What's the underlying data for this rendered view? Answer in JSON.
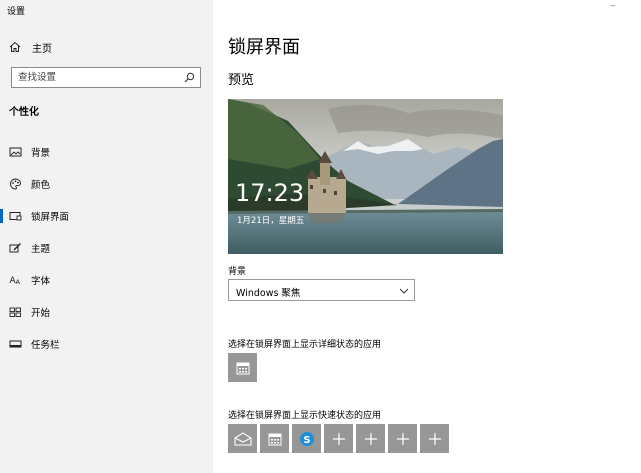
{
  "app": {
    "title": "设置",
    "minimize_glyph": "‒"
  },
  "sidebar": {
    "home_label": "主页",
    "search": {
      "placeholder": "查找设置",
      "value": ""
    },
    "section_title": "个性化",
    "items": [
      {
        "label": "背景",
        "icon": "picture-icon"
      },
      {
        "label": "颜色",
        "icon": "palette-icon"
      },
      {
        "label": "锁屏界面",
        "icon": "lockscreen-icon",
        "active": true
      },
      {
        "label": "主题",
        "icon": "theme-brush-icon"
      },
      {
        "label": "字体",
        "icon": "font-icon"
      },
      {
        "label": "开始",
        "icon": "start-grid-icon"
      },
      {
        "label": "任务栏",
        "icon": "taskbar-icon"
      }
    ]
  },
  "main": {
    "title": "锁屏界面",
    "preview_heading": "预览",
    "preview": {
      "time": "17:23",
      "date": "1月21日，星期五"
    },
    "background_label": "背景",
    "background_select": {
      "value": "Windows 聚焦"
    },
    "detailed_status_label": "选择在锁屏界面上显示详细状态的应用",
    "detailed_status_apps": [
      {
        "icon": "calendar-icon"
      }
    ],
    "quick_status_label": "选择在锁屏界面上显示快速状态的应用",
    "quick_status_apps": [
      {
        "icon": "mail-icon"
      },
      {
        "icon": "calendar-icon"
      },
      {
        "icon": "skype-icon"
      },
      {
        "icon": "plus-icon"
      },
      {
        "icon": "plus-icon"
      },
      {
        "icon": "plus-icon"
      },
      {
        "icon": "plus-icon"
      }
    ]
  },
  "colors": {
    "accent": "#0067c0",
    "sidebar_bg": "#f2f2f2",
    "tile_bg": "#979797"
  }
}
